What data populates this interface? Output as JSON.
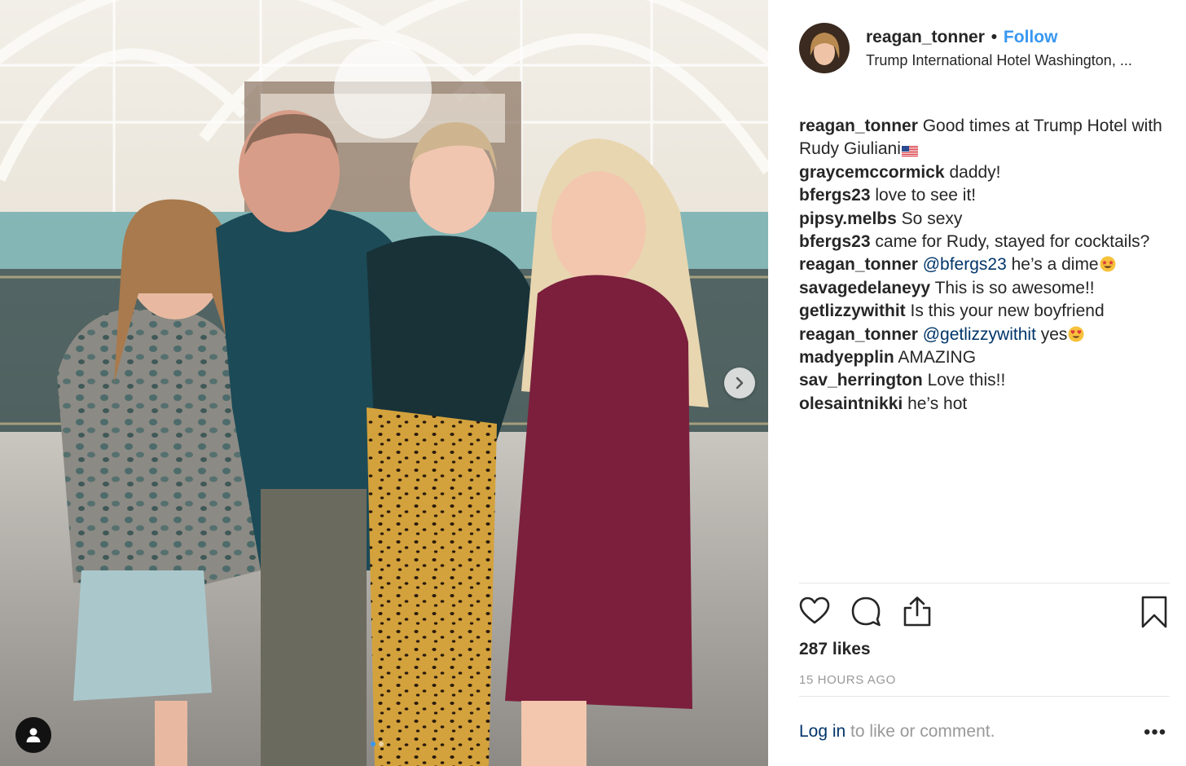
{
  "post": {
    "username": "reagan_tonner",
    "separator": "•",
    "follow_label": "Follow",
    "location": "Trump International Hotel Washington, ..."
  },
  "comments": [
    {
      "user": "reagan_tonner",
      "parts": [
        {
          "t": "text",
          "v": "Good times at Trump Hotel with Rudy Giuliani"
        },
        {
          "t": "emoji",
          "v": "us-flag"
        }
      ]
    },
    {
      "user": "graycemccormick",
      "parts": [
        {
          "t": "text",
          "v": "daddy!"
        }
      ]
    },
    {
      "user": "bfergs23",
      "parts": [
        {
          "t": "text",
          "v": "love to see it!"
        }
      ]
    },
    {
      "user": "pipsy.melbs",
      "parts": [
        {
          "t": "text",
          "v": "So sexy"
        }
      ]
    },
    {
      "user": "bfergs23",
      "parts": [
        {
          "t": "text",
          "v": "came for Rudy, stayed for cocktails?"
        }
      ]
    },
    {
      "user": "reagan_tonner",
      "parts": [
        {
          "t": "mention",
          "v": "@bfergs23"
        },
        {
          "t": "text",
          "v": " he’s a dime"
        },
        {
          "t": "emoji",
          "v": "star-struck"
        }
      ]
    },
    {
      "user": "savagedelaneyy",
      "parts": [
        {
          "t": "text",
          "v": "This is so awesome!!"
        }
      ]
    },
    {
      "user": "getlizzywithit",
      "parts": [
        {
          "t": "text",
          "v": "Is this your new boyfriend"
        }
      ]
    },
    {
      "user": "reagan_tonner",
      "parts": [
        {
          "t": "mention",
          "v": "@getlizzywithit"
        },
        {
          "t": "text",
          "v": " yes"
        },
        {
          "t": "emoji",
          "v": "heart-eyes"
        }
      ]
    },
    {
      "user": "madyepplin",
      "parts": [
        {
          "t": "text",
          "v": "AMAZING"
        }
      ]
    },
    {
      "user": "sav_herrington",
      "parts": [
        {
          "t": "text",
          "v": "Love this!!"
        }
      ]
    },
    {
      "user": "olesaintnikki",
      "parts": [
        {
          "t": "text",
          "v": "he’s hot"
        }
      ]
    }
  ],
  "actions": {
    "icons": [
      "heart-icon",
      "comment-icon",
      "share-icon",
      "bookmark-icon"
    ]
  },
  "likes": "287 likes",
  "timestamp": "15 HOURS AGO",
  "login": {
    "link": "Log in",
    "rest": " to like or comment."
  },
  "more_label": "•••",
  "colors": {
    "link_blue": "#3897f0",
    "mention_navy": "#003569",
    "muted": "#999999",
    "text": "#262626"
  }
}
